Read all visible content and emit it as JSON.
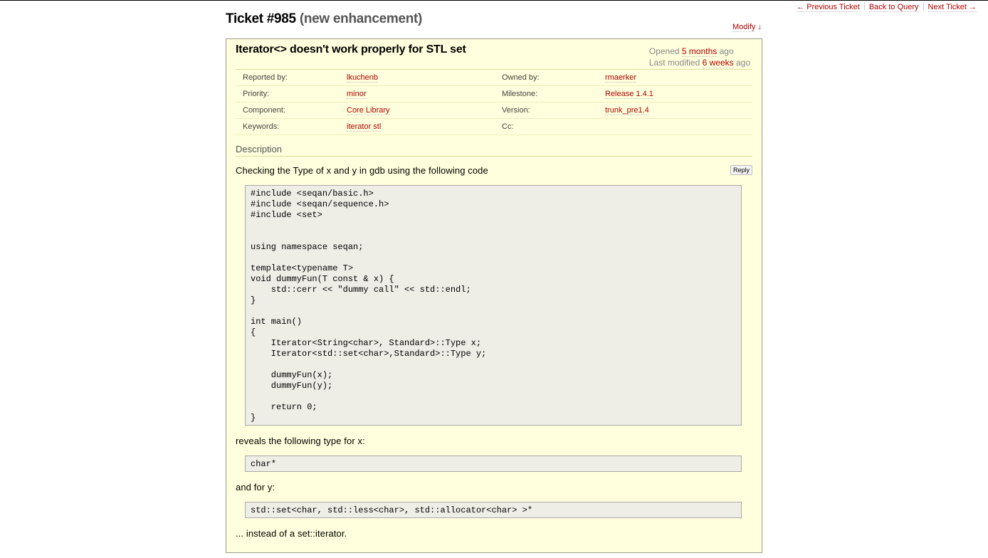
{
  "nav": {
    "prev": "← Previous Ticket",
    "back": "Back to Query",
    "next": "Next Ticket →"
  },
  "ticket": {
    "number": "Ticket #985",
    "status": "(new enhancement)",
    "modify": "Modify",
    "modify_arrow": "↓",
    "summary": "Iterator<> doesn't work properly for STL set",
    "opened_prefix": "Opened",
    "opened": "5 months",
    "opened_suffix": "ago",
    "modified_prefix": "Last modified",
    "modified": "6 weeks",
    "modified_suffix": "ago"
  },
  "properties": [
    {
      "label1": "Reported by:",
      "value1": "lkuchenb",
      "label2": "Owned by:",
      "value2": "rmaerker"
    },
    {
      "label1": "Priority:",
      "value1": "minor",
      "label2": "Milestone:",
      "value2": "Release 1.4.1"
    },
    {
      "label1": "Component:",
      "value1": "Core Library",
      "label2": "Version:",
      "value2": "trunk_pre1.4"
    },
    {
      "label1": "Keywords:",
      "value1": "iterator stl",
      "label2": "Cc:",
      "value2": ""
    }
  ],
  "description": {
    "heading": "Description",
    "reply": "Reply",
    "intro": "Checking the Type of x and y in gdb using the following code",
    "code_main": "#include <seqan/basic.h>\n#include <seqan/sequence.h>\n#include <set>\n\n\nusing namespace seqan;\n\ntemplate<typename T>\nvoid dummyFun(T const & x) {\n    std::cerr << \"dummy call\" << std::endl;\n}\n\nint main()\n{\n    Iterator<String<char>, Standard>::Type x;\n    Iterator<std::set<char>,Standard>::Type y;\n\n    dummyFun(x);\n    dummyFun(y);\n\n    return 0;\n}",
    "text_x": "reveals the following type for x:",
    "code_x": "char*",
    "text_y": "and for y:",
    "code_y": "std::set<char, std::less<char>, std::allocator<char> >*",
    "closing": "... instead of a set::iterator."
  }
}
